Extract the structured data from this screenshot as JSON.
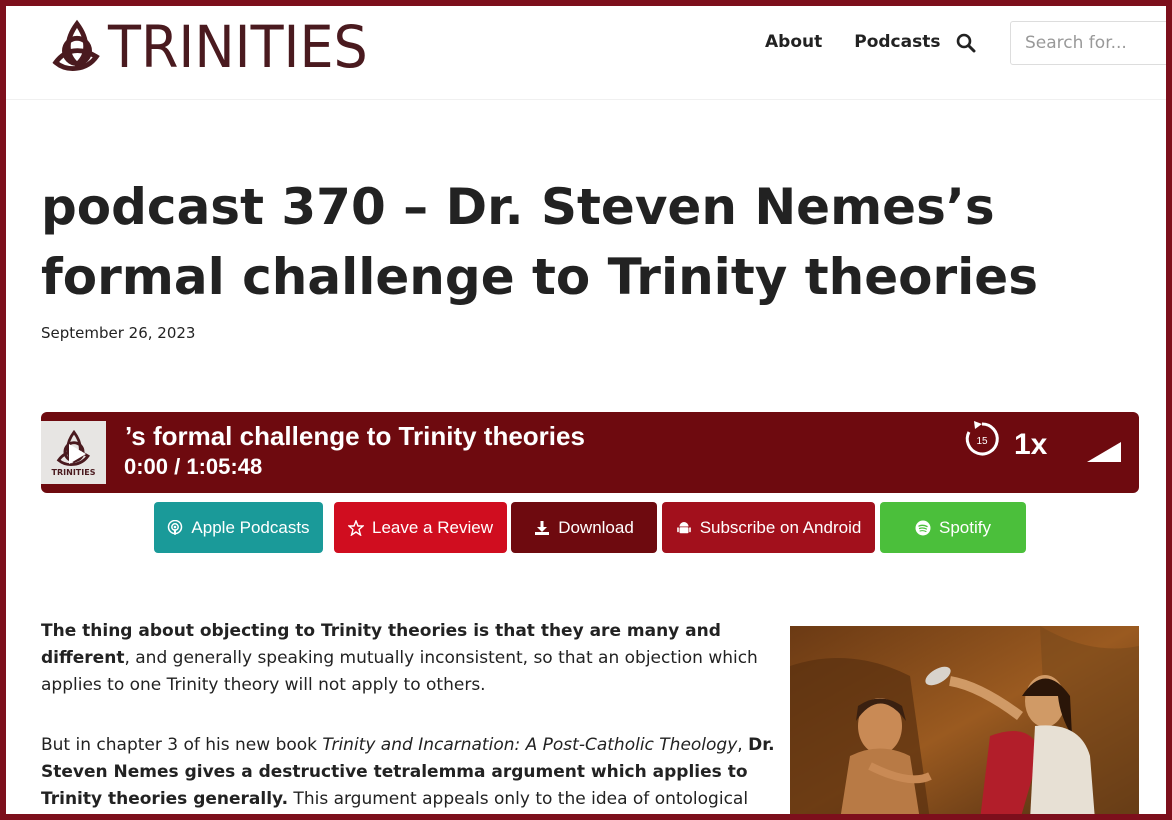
{
  "header": {
    "site_name": "TRINITIES",
    "nav": {
      "about": "About",
      "podcasts": "Podcasts"
    },
    "search_placeholder": "Search for..."
  },
  "post": {
    "title": "podcast 370 – Dr. Steven Nemes’s formal challenge to Trinity theories",
    "date": "September 26, 2023"
  },
  "player": {
    "thumb_label": "TRINITIES",
    "scrolling_title": "’s formal challenge to Trinity theories",
    "time": "0:00 / 1:05:48",
    "skip_seconds": "15",
    "speed": "1x"
  },
  "buttons": {
    "apple": "Apple Podcasts",
    "review": "Leave a Review",
    "download": "Download",
    "android": "Subscribe on Android",
    "spotify": "Spotify"
  },
  "content": {
    "p1_bold": "The thing about objecting to Trinity theories is that they are many and different",
    "p1_rest": ", and generally speaking mutually inconsistent, so that an objection which applies to one Trinity theory will not apply to others.",
    "p2_start": "But in chapter 3 of his new book ",
    "p2_book": "Trinity and Incarnation: A Post-Catholic Theology",
    "p2_comma": ", ",
    "p2_bold": "Dr. Steven Nemes gives a destructive tetralemma argument which applies to Trinity theories generally.",
    "p2_rest": " This argument appeals only to the idea of ontological"
  },
  "colors": {
    "frame": "#7d0f1c",
    "player_bg": "#6e0a0f",
    "apple": "#1a9a99",
    "review": "#d00d1f",
    "download": "#6e0a0f",
    "android": "#a2101c",
    "spotify": "#4bbf3b"
  }
}
